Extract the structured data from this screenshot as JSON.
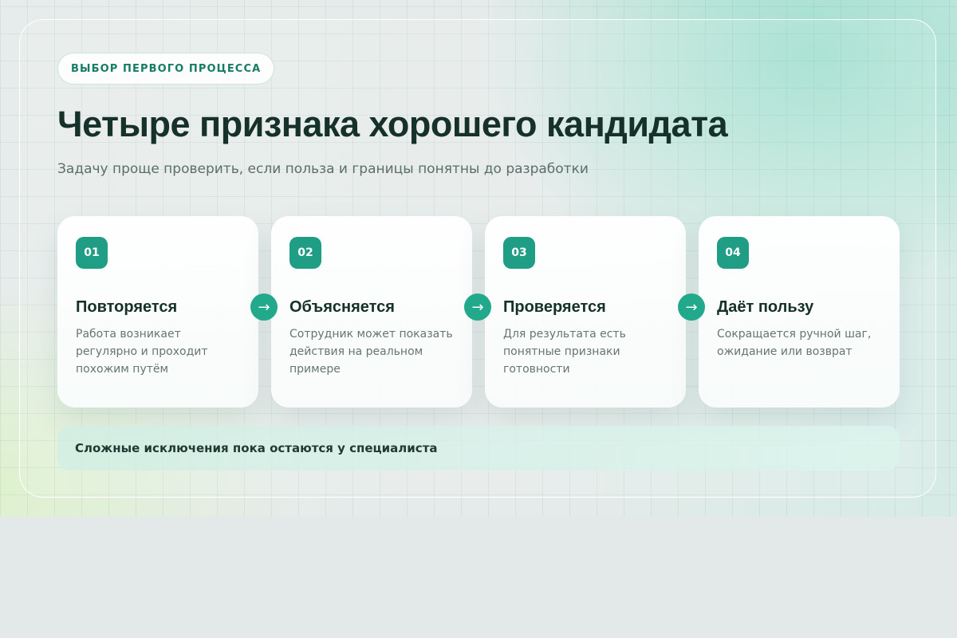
{
  "eyebrow": "ВЫБОР ПЕРВОГО ПРОЦЕССА",
  "title": "Четыре признака хорошего кандидата",
  "subtitle": "Задачу проще проверить, если польза и границы понятны до разработки",
  "cards": [
    {
      "number": "01",
      "title": "Повторяется",
      "description": "Работа возникает регулярно и проходит похожим путём"
    },
    {
      "number": "02",
      "title": "Объясняется",
      "description": "Сотрудник может показать действия на реальном примере"
    },
    {
      "number": "03",
      "title": "Проверяется",
      "description": "Для результата есть понятные признаки готовности"
    },
    {
      "number": "04",
      "title": "Даёт пользу",
      "description": "Сокращается ручной шаг, ожидание или возврат"
    }
  ],
  "arrow_glyph": "→",
  "note": "Сложные исключения пока остаются у специалиста",
  "colors": {
    "accent": "#1f9e85",
    "title": "#16312a",
    "eyebrow": "#177c66"
  }
}
